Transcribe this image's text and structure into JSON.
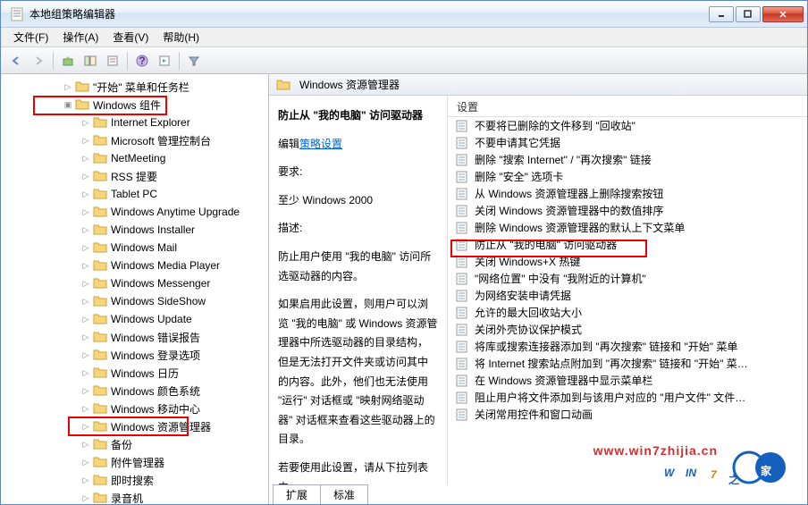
{
  "window": {
    "title": "本地组策略编辑器"
  },
  "menu": {
    "file": "文件(F)",
    "action": "操作(A)",
    "view": "查看(V)",
    "help": "帮助(H)"
  },
  "tree": {
    "item_start_menu": "\"开始\"  菜单和任务栏",
    "item_win_components": "Windows 组件",
    "children": [
      "Internet Explorer",
      "Microsoft 管理控制台",
      "NetMeeting",
      "RSS 提要",
      "Tablet PC",
      "Windows Anytime Upgrade",
      "Windows Installer",
      "Windows Mail",
      "Windows Media Player",
      "Windows Messenger",
      "Windows SideShow",
      "Windows Update",
      "Windows 错误报告",
      "Windows 登录选项",
      "Windows 日历",
      "Windows 颜色系统",
      "Windows 移动中心",
      "Windows 资源管理器",
      "备份",
      "附件管理器",
      "即时搜索",
      "录音机"
    ]
  },
  "right": {
    "header": "Windows 资源管理器",
    "settings_label": "设置",
    "tabs": {
      "extended": "扩展",
      "standard": "标准"
    }
  },
  "desc": {
    "title": "防止从 \"我的电脑\" 访问驱动器",
    "edit_prefix": "编辑",
    "edit_link": "策略设置",
    "req_label": "要求:",
    "req_value": "至少 Windows 2000",
    "desc_label": "描述:",
    "desc_body": "防止用户使用 \"我的电脑\" 访问所选驱动器的内容。",
    "desc_body2": "如果启用此设置，则用户可以浏览 \"我的电脑\" 或 Windows 资源管理器中所选驱动器的目录结构，但是无法打开文件夹或访问其中的内容。此外，他们也无法使用 \"运行\" 对话框或 \"映射网络驱动器\" 对话框来查看这些驱动器上的目录。",
    "desc_body3": "若要使用此设置，请从下拉列表中"
  },
  "settings": [
    "不要将已删除的文件移到 \"回收站\"",
    "不要申请其它凭据",
    "删除 \"搜索 Internet\" / \"再次搜索\" 链接",
    "删除 \"安全\" 选项卡",
    "从 Windows 资源管理器上删除搜索按钮",
    "关闭 Windows 资源管理器中的数值排序",
    "删除 Windows 资源管理器的默认上下文菜单",
    "防止从 \"我的电脑\" 访问驱动器",
    "关闭 Windows+X 热键",
    "\"网络位置\" 中没有 \"我附近的计算机\"",
    "为网络安装申请凭据",
    "允许的最大回收站大小",
    "关闭外壳协议保护模式",
    "将库或搜索连接器添加到 \"再次搜索\" 链接和 \"开始\" 菜单",
    "将 Internet 搜索站点附加到 \"再次搜索\" 链接和 \"开始\" 菜…",
    "在 Windows 资源管理器中显示菜单栏",
    "阻止用户将文件添加到与该用户对应的 \"用户文件\" 文件…",
    "关闭常用控件和窗口动画"
  ],
  "watermark": {
    "url": "www.win7zhijia.cn"
  }
}
